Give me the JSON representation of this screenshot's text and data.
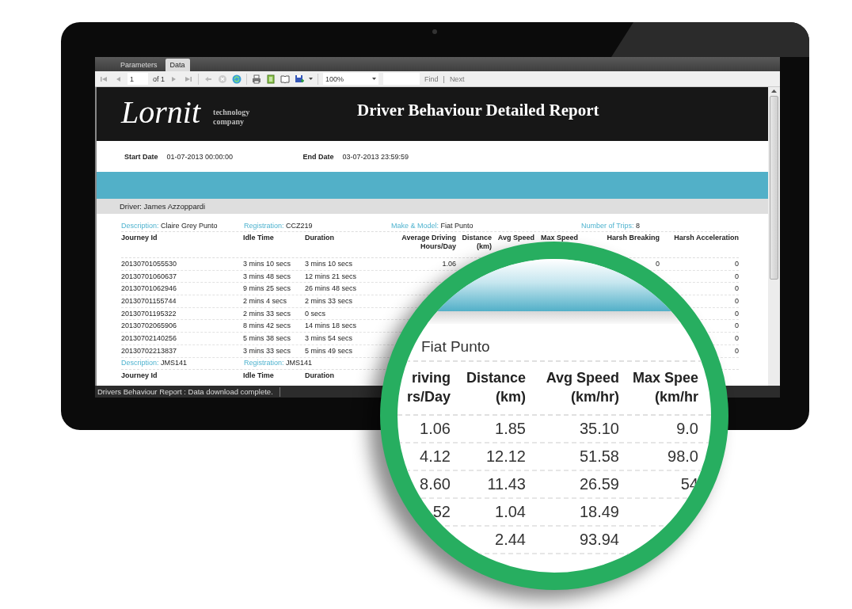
{
  "tabs": [
    {
      "label": "Parameters",
      "selected": false
    },
    {
      "label": "Data",
      "selected": true
    }
  ],
  "toolbar": {
    "page": "1",
    "page_count": "of 1",
    "zoom": "100%",
    "find": "Find",
    "separator": "|",
    "next": "Next"
  },
  "report": {
    "logo": "Lornit",
    "tagline": "technology company",
    "title": "Driver Behaviour Detailed Report",
    "start_date": {
      "label": "Start Date",
      "value": "01-07-2013 00:00:00"
    },
    "end_date": {
      "label": "End Date",
      "value": "03-07-2013 23:59:59"
    },
    "driver": "Driver: James Azzoppardi",
    "vehicles": [
      {
        "fields": [
          {
            "label": "Description:",
            "value": "Claire Grey Punto"
          },
          {
            "label": "Registration:",
            "value": "CCZ219"
          },
          {
            "label": "Make & Model:",
            "value": "Fiat Punto"
          },
          {
            "label": "Number of Trips:",
            "value": "8"
          }
        ],
        "columns": {
          "journey_id": [
            "Journey Id"
          ],
          "idle_time": [
            "Idle Time"
          ],
          "duration": [
            "Duration"
          ],
          "avg_driving": [
            "Average Driving",
            "Hours/Day"
          ],
          "distance": [
            "Distance",
            "(km)"
          ],
          "avg_speed": [
            "Avg Speed"
          ],
          "max_speed": [
            "Max Speed"
          ],
          "harsh_breaking": [
            "Harsh Breaking"
          ],
          "harsh_acceleration": [
            "Harsh Acceleration"
          ]
        },
        "rows": [
          {
            "journey_id": "20130701055530",
            "idle_time": "3 mins 10 secs",
            "duration": "3 mins 10 secs",
            "avg_driving": "1.06",
            "harsh_breaking": "0",
            "harsh_acceleration": "0"
          },
          {
            "journey_id": "20130701060637",
            "idle_time": "3 mins 48 secs",
            "duration": "12 mins 21 secs",
            "harsh_acceleration": "0"
          },
          {
            "journey_id": "20130701062946",
            "idle_time": "9 mins 25 secs",
            "duration": "26 mins 48 secs",
            "harsh_acceleration": "0"
          },
          {
            "journey_id": "20130701155744",
            "idle_time": "2 mins 4 secs",
            "duration": "2 mins 33 secs",
            "harsh_acceleration": "0"
          },
          {
            "journey_id": "20130701195322",
            "idle_time": "2 mins 33 secs",
            "duration": "0 secs",
            "harsh_acceleration": "0"
          },
          {
            "journey_id": "20130702065906",
            "idle_time": "8 mins 42 secs",
            "duration": "14 mins 18 secs",
            "harsh_acceleration": "0"
          },
          {
            "journey_id": "20130702140256",
            "idle_time": "5 mins 38 secs",
            "duration": "3 mins 54 secs",
            "harsh_acceleration": "0"
          },
          {
            "journey_id": "20130702213837",
            "idle_time": "3 mins 33 secs",
            "duration": "5 mins 49 secs",
            "harsh_acceleration": "0"
          }
        ]
      },
      {
        "fields": [
          {
            "label": "Description:",
            "value": "JMS141"
          },
          {
            "label": "Registration:",
            "value": "JMS141"
          }
        ],
        "columns": {
          "journey_id": [
            "Journey Id"
          ],
          "idle_time": [
            "Idle Time"
          ],
          "duration": [
            "Duration"
          ]
        }
      }
    ]
  },
  "status_bar": "Drivers Behaviour Report : Data download complete.",
  "magnifier": {
    "caption": "Fiat Punto",
    "columns": [
      {
        "lines": [
          "riving",
          "rs/Day"
        ],
        "values": [
          "1.06",
          "4.12",
          "8.60",
          "52"
        ]
      },
      {
        "lines": [
          "Distance",
          "(km)"
        ],
        "values": [
          "1.85",
          "12.12",
          "11.43",
          "1.04",
          "2.44"
        ]
      },
      {
        "lines": [
          "Avg Speed",
          "(km/hr)"
        ],
        "values": [
          "35.10",
          "51.58",
          "26.59",
          "18.49",
          "93.94"
        ]
      },
      {
        "lines": [
          "Max Spee",
          "(km/hr"
        ],
        "values": [
          "9.0",
          "98.0",
          "54"
        ]
      }
    ]
  }
}
